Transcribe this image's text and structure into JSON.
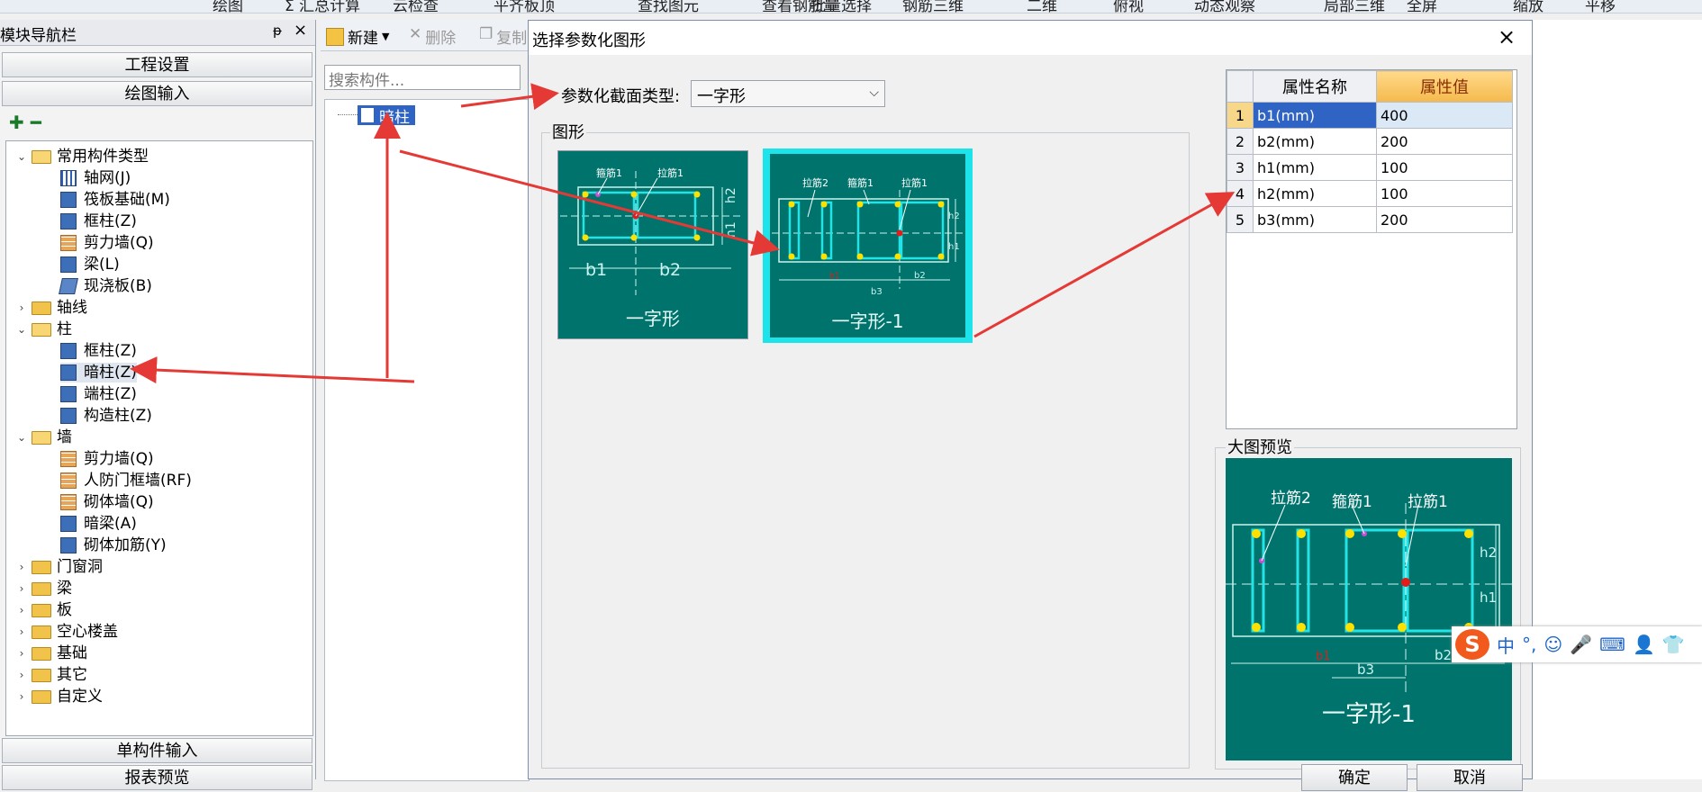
{
  "toolbar": {
    "items": [
      "绘图",
      "Σ 汇总计算",
      "云检查",
      "平齐板顶",
      "查找图元",
      "查看钢筋量",
      "批量选择",
      "钢筋三维",
      "二维",
      "俯视",
      "动态观察",
      "局部三维",
      "全屏",
      "缩放",
      "平移"
    ]
  },
  "nav": {
    "title": "模块导航栏",
    "pin": "ᵽ",
    "close": "×",
    "project_settings": "工程设置",
    "drawing_input": "绘图输入",
    "single_input": "单构件输入",
    "report_preview": "报表预览",
    "tree": [
      {
        "label": "常用构件类型",
        "type": "folder",
        "open": true,
        "level": 0
      },
      {
        "label": "轴网(J)",
        "type": "leaf",
        "icon": "axis-grid-icon",
        "level": 1
      },
      {
        "label": "筏板基础(M)",
        "type": "leaf",
        "icon": "raft-foundation-icon",
        "level": 1
      },
      {
        "label": "框柱(Z)",
        "type": "leaf",
        "icon": "frame-column-icon",
        "level": 1
      },
      {
        "label": "剪力墙(Q)",
        "type": "leaf",
        "icon": "shear-wall-icon",
        "level": 1
      },
      {
        "label": "梁(L)",
        "type": "leaf",
        "icon": "beam-icon",
        "level": 1
      },
      {
        "label": "现浇板(B)",
        "type": "leaf",
        "icon": "slab-icon",
        "level": 1
      },
      {
        "label": "轴线",
        "type": "folder",
        "open": false,
        "level": 0
      },
      {
        "label": "柱",
        "type": "folder",
        "open": true,
        "level": 0
      },
      {
        "label": "框柱(Z)",
        "type": "leaf",
        "icon": "frame-column-icon",
        "level": 1
      },
      {
        "label": "暗柱(Z)",
        "type": "leaf",
        "icon": "hidden-column-icon",
        "level": 1,
        "selected": true
      },
      {
        "label": "端柱(Z)",
        "type": "leaf",
        "icon": "end-column-icon",
        "level": 1
      },
      {
        "label": "构造柱(Z)",
        "type": "leaf",
        "icon": "construction-column-icon",
        "level": 1
      },
      {
        "label": "墙",
        "type": "folder",
        "open": true,
        "level": 0
      },
      {
        "label": "剪力墙(Q)",
        "type": "leaf",
        "icon": "shear-wall-icon",
        "level": 1
      },
      {
        "label": "人防门框墙(RF)",
        "type": "leaf",
        "icon": "door-frame-wall-icon",
        "level": 1
      },
      {
        "label": "砌体墙(Q)",
        "type": "leaf",
        "icon": "masonry-wall-icon",
        "level": 1
      },
      {
        "label": "暗梁(A)",
        "type": "leaf",
        "icon": "hidden-beam-icon",
        "level": 1
      },
      {
        "label": "砌体加筋(Y)",
        "type": "leaf",
        "icon": "masonry-rebar-icon",
        "level": 1
      },
      {
        "label": "门窗洞",
        "type": "folder",
        "open": false,
        "level": 0
      },
      {
        "label": "梁",
        "type": "folder",
        "open": false,
        "level": 0
      },
      {
        "label": "板",
        "type": "folder",
        "open": false,
        "level": 0
      },
      {
        "label": "空心楼盖",
        "type": "folder",
        "open": false,
        "level": 0
      },
      {
        "label": "基础",
        "type": "folder",
        "open": false,
        "level": 0
      },
      {
        "label": "其它",
        "type": "folder",
        "open": false,
        "level": 0
      },
      {
        "label": "自定义",
        "type": "folder",
        "open": false,
        "level": 0
      }
    ]
  },
  "mid": {
    "new_label": "新建",
    "delete_label": "删除",
    "copy_label": "复制",
    "search_placeholder": "搜索构件...",
    "component": "暗柱"
  },
  "dialog": {
    "title": "选择参数化图形",
    "close": "×",
    "type_label": "参数化截面类型:",
    "type_value": "一字形",
    "shapes_label": "图形",
    "shapes": [
      {
        "caption": "一字形",
        "labels": [
          "箍筋1",
          "拉筋1",
          "b1",
          "b2",
          "h1",
          "h2"
        ]
      },
      {
        "caption": "一字形-1",
        "labels": [
          "拉筋2",
          "箍筋1",
          "拉筋1",
          "h2",
          "h1",
          "b1",
          "b3",
          "b2"
        ],
        "selected": true
      }
    ],
    "table": {
      "headers": [
        "属性名称",
        "属性值"
      ],
      "rows": [
        {
          "index": "1",
          "name": "b1(mm)",
          "value": "400"
        },
        {
          "index": "2",
          "name": "b2(mm)",
          "value": "200"
        },
        {
          "index": "3",
          "name": "h1(mm)",
          "value": "100"
        },
        {
          "index": "4",
          "name": "h2(mm)",
          "value": "100"
        },
        {
          "index": "5",
          "name": "b3(mm)",
          "value": "200"
        }
      ]
    },
    "preview_label": "大图预览",
    "preview": {
      "caption": "一字形-1",
      "labels": [
        "拉筋2",
        "箍筋1",
        "拉筋1",
        "h2",
        "h1",
        "b1",
        "b2",
        "b3"
      ]
    },
    "ok_label": "确定",
    "cancel_label": "取消"
  },
  "ime": {
    "logo": "S",
    "mode": "中",
    "punct": "°,"
  },
  "colors": {
    "teal": "#00746c",
    "selection": "#2f63c4",
    "arrow": "#e53935",
    "highlight": "#1de3ea"
  }
}
